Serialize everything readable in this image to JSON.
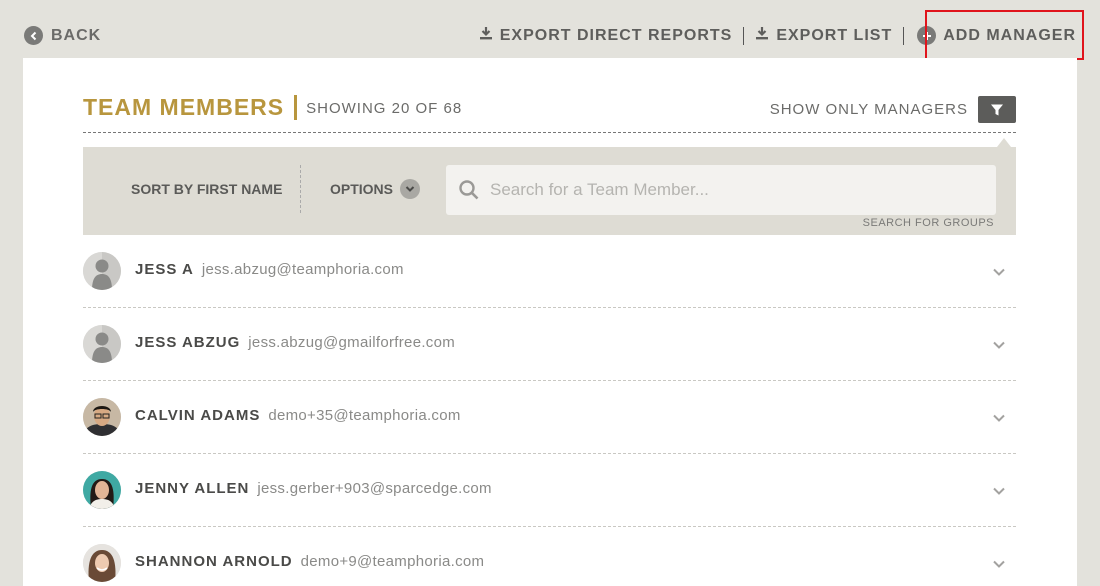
{
  "topbar": {
    "back_label": "BACK",
    "export_direct_reports_label": "EXPORT DIRECT REPORTS",
    "export_list_label": "EXPORT LIST",
    "add_manager_label": "ADD MANAGER"
  },
  "header": {
    "title": "TEAM MEMBERS",
    "showing": "SHOWING 20 OF 68",
    "show_only_managers": "SHOW ONLY MANAGERS"
  },
  "toolbar": {
    "sort_label": "SORT BY FIRST NAME",
    "options_label": "OPTIONS",
    "search_placeholder": "Search for a Team Member...",
    "search_groups_label": "SEARCH FOR GROUPS"
  },
  "members": [
    {
      "name": "JESS A",
      "email": "jess.abzug@teamphoria.com",
      "avatar": "default-avatar"
    },
    {
      "name": "JESS ABZUG",
      "email": "jess.abzug@gmailforfree.com",
      "avatar": "default-avatar"
    },
    {
      "name": "CALVIN ADAMS",
      "email": "demo+35@teamphoria.com",
      "avatar": "photo-man-glasses"
    },
    {
      "name": "JENNY ALLEN",
      "email": "jess.gerber+903@sparcedge.com",
      "avatar": "photo-woman-dark-hair"
    },
    {
      "name": "SHANNON ARNOLD",
      "email": "demo+9@teamphoria.com",
      "avatar": "photo-woman-brown-hair"
    }
  ],
  "colors": {
    "accent_gold": "#b8963e",
    "background": "#e3e2dc",
    "toolbar": "#dedcd4",
    "highlight_red": "#e0141c"
  }
}
